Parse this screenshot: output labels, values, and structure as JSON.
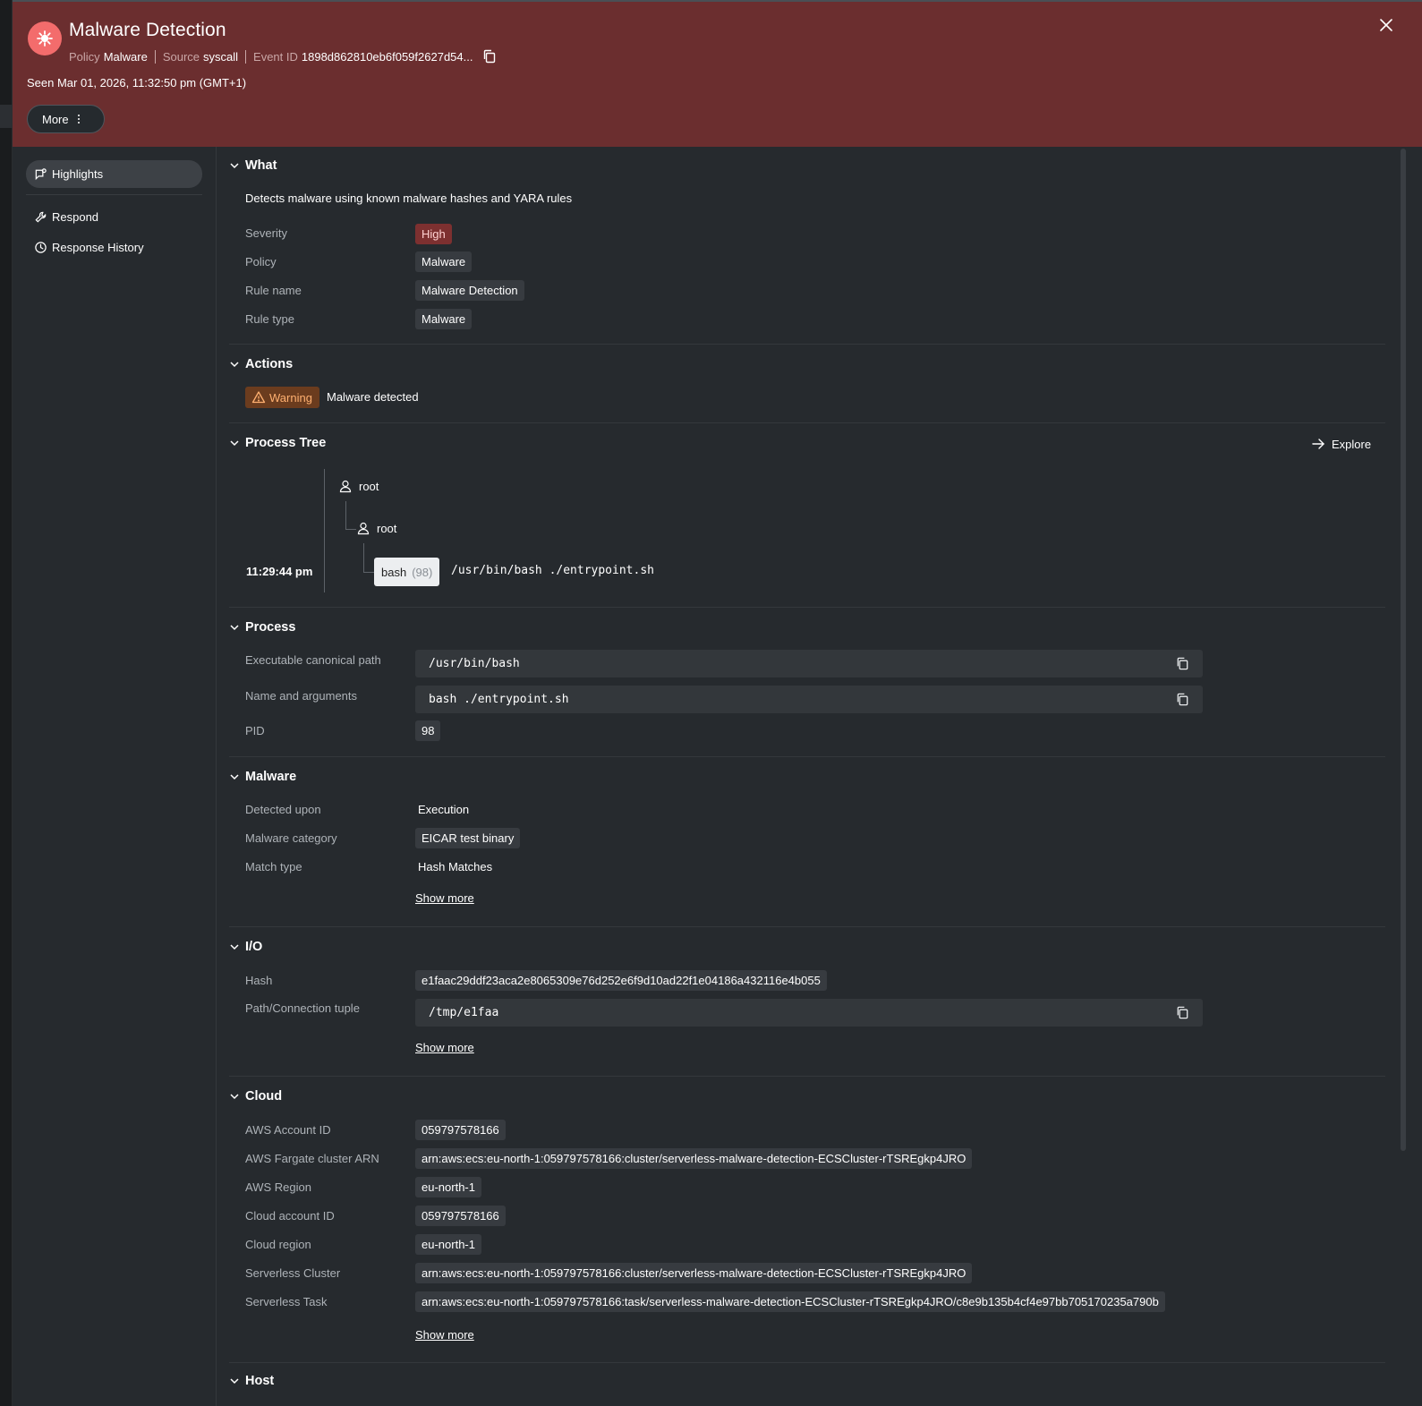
{
  "header": {
    "title": "Malware Detection",
    "policy_label": "Policy",
    "policy_value": "Malware",
    "source_label": "Source",
    "source_value": "syscall",
    "event_label": "Event ID",
    "event_value": "1898d862810eb6f059f2627d54...",
    "seen": "Seen Mar 01, 2026, 11:32:50 pm (GMT+1)",
    "more_label": "More",
    "icon": "bug-icon",
    "accent": "#6b2e2f"
  },
  "sidebar": {
    "items": [
      {
        "label": "Highlights",
        "icon": "highlights-icon"
      },
      {
        "label": "Respond",
        "icon": "wrench-icon"
      },
      {
        "label": "Response History",
        "icon": "clock-icon"
      }
    ]
  },
  "what": {
    "title": "What",
    "description": "Detects malware using known malware hashes and YARA rules",
    "rows": [
      {
        "label": "Severity",
        "value": "High"
      },
      {
        "label": "Policy",
        "value": "Malware"
      },
      {
        "label": "Rule name",
        "value": "Malware Detection"
      },
      {
        "label": "Rule type",
        "value": "Malware"
      }
    ]
  },
  "actions": {
    "title": "Actions",
    "badge": "Warning",
    "text": "Malware detected"
  },
  "process_tree": {
    "title": "Process Tree",
    "explore": "Explore",
    "nodes": [
      "root",
      "root"
    ],
    "time": "11:29:44 pm",
    "proc_name": "bash",
    "proc_pid": "(98)",
    "command": "/usr/bin/bash ./entrypoint.sh"
  },
  "process": {
    "title": "Process",
    "rows": [
      {
        "label": "Executable canonical path",
        "value": "/usr/bin/bash"
      },
      {
        "label": "Name and arguments",
        "value": "bash ./entrypoint.sh"
      },
      {
        "label": "PID",
        "value": "98"
      }
    ]
  },
  "malware": {
    "title": "Malware",
    "rows": [
      {
        "label": "Detected upon",
        "value": "Execution"
      },
      {
        "label": "Malware category",
        "value": "EICAR test binary"
      },
      {
        "label": "Match type",
        "value": "Hash Matches"
      }
    ],
    "show_more": "Show more"
  },
  "io": {
    "title": "I/O",
    "rows": [
      {
        "label": "Hash",
        "value": "e1faac29ddf23aca2e8065309e76d252e6f9d10ad22f1e04186a432116e4b055"
      },
      {
        "label": "Path/Connection tuple",
        "value": "/tmp/e1faa"
      }
    ],
    "show_more": "Show more"
  },
  "cloud": {
    "title": "Cloud",
    "rows": [
      {
        "label": "AWS Account ID",
        "value": "059797578166"
      },
      {
        "label": "AWS Fargate cluster ARN",
        "value": "arn:aws:ecs:eu-north-1:059797578166:cluster/serverless-malware-detection-ECSCluster-rTSREgkp4JRO"
      },
      {
        "label": "AWS Region",
        "value": "eu-north-1"
      },
      {
        "label": "Cloud account ID",
        "value": "059797578166"
      },
      {
        "label": "Cloud region",
        "value": "eu-north-1"
      },
      {
        "label": "Serverless Cluster",
        "value": "arn:aws:ecs:eu-north-1:059797578166:cluster/serverless-malware-detection-ECSCluster-rTSREgkp4JRO"
      },
      {
        "label": "Serverless Task",
        "value": "arn:aws:ecs:eu-north-1:059797578166:task/serverless-malware-detection-ECSCluster-rTSREgkp4JRO/c8e9b135b4cf4e97bb705170235a790b"
      }
    ],
    "show_more": "Show more"
  },
  "host": {
    "title": "Host"
  }
}
